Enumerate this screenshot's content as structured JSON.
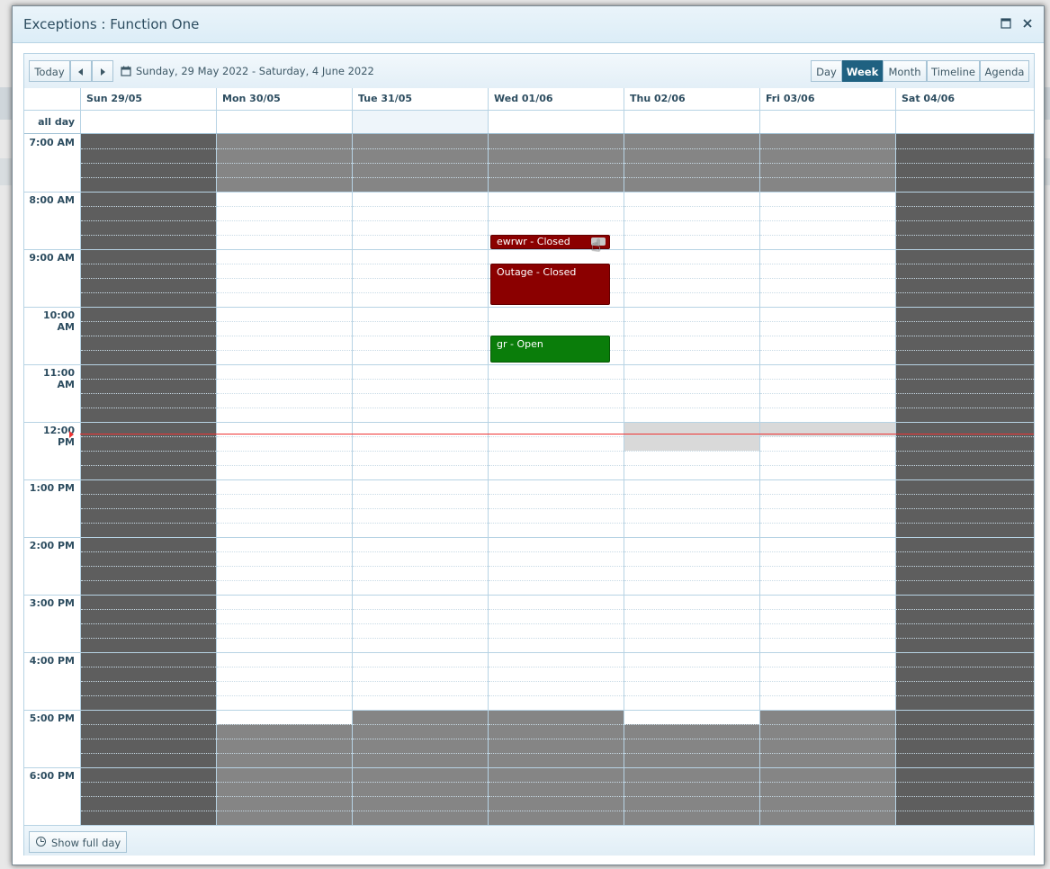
{
  "window": {
    "title": "Exceptions : Function One",
    "maximize_icon": "window-maximize-icon",
    "close_icon": "close-icon"
  },
  "toolbar": {
    "today_label": "Today",
    "prev_icon": "arrow-left-icon",
    "next_icon": "arrow-right-icon",
    "range_label": "Sunday, 29 May 2022 - Saturday, 4 June 2022",
    "views": [
      {
        "label": "Day",
        "active": false
      },
      {
        "label": "Week",
        "active": true
      },
      {
        "label": "Month",
        "active": false
      },
      {
        "label": "Timeline",
        "active": false
      },
      {
        "label": "Agenda",
        "active": false
      }
    ]
  },
  "days": [
    "Sun 29/05",
    "Mon 30/05",
    "Tue 31/05",
    "Wed 01/06",
    "Thu 02/06",
    "Fri 03/06",
    "Sat 04/06"
  ],
  "allday_label": "all day",
  "times": [
    "7:00 AM",
    "8:00 AM",
    "9:00 AM",
    "10:00 AM",
    "11:00 AM",
    "12:00 PM",
    "1:00 PM",
    "2:00 PM",
    "3:00 PM",
    "4:00 PM",
    "5:00 PM",
    "6:00 PM"
  ],
  "events": [
    {
      "title": "ewrwr - Closed",
      "day": 3,
      "start": "8:45 AM",
      "end": "9:00 AM",
      "status": "closed"
    },
    {
      "title": "Outage - Closed",
      "day": 3,
      "start": "9:15 AM",
      "end": "10:00 AM",
      "status": "closed"
    },
    {
      "title": "gr - Open",
      "day": 3,
      "start": "10:30 AM",
      "end": "11:00 AM",
      "status": "open"
    }
  ],
  "colors": {
    "closed": "#8b0000",
    "open": "#0a7d0a",
    "accent": "#1f6181",
    "now_line": "#e33333"
  },
  "footer": {
    "show_full_day_label": "Show full day",
    "clock_icon": "clock-icon"
  }
}
